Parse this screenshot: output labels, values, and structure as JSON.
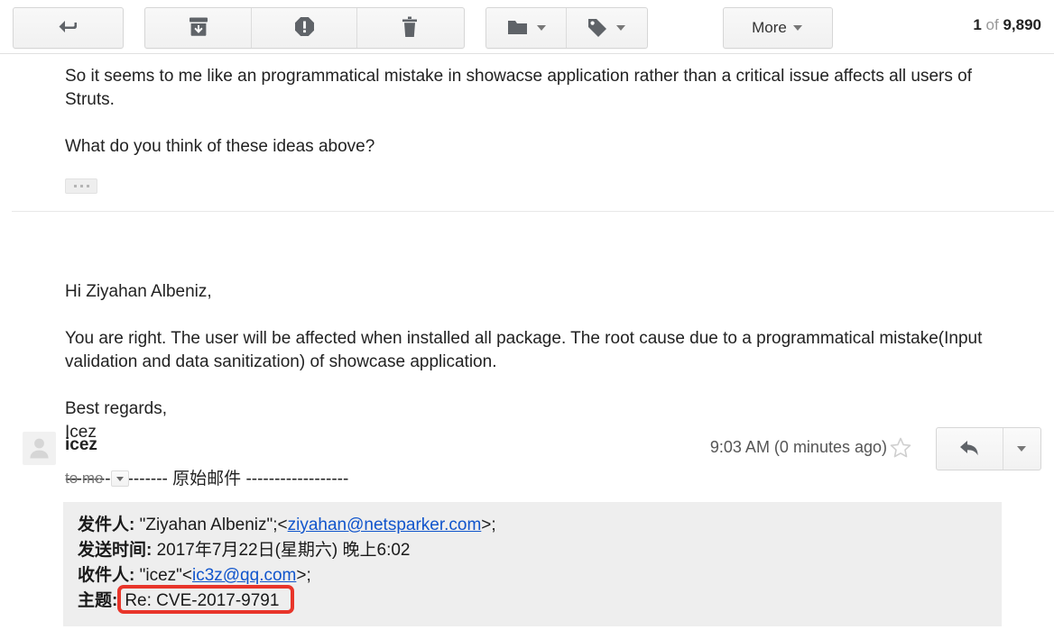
{
  "toolbar": {
    "buttons": [
      {
        "name": "back-to-inbox",
        "icon": "back-arrow-icon",
        "label": ""
      },
      {
        "name": "archive",
        "icon": "archive-icon",
        "label": ""
      },
      {
        "name": "report-spam",
        "icon": "report-spam-icon",
        "label": ""
      },
      {
        "name": "delete",
        "icon": "trash-icon",
        "label": ""
      },
      {
        "name": "move-to",
        "icon": "folder-icon",
        "label": ""
      },
      {
        "name": "labels",
        "icon": "tag-icon",
        "label": ""
      },
      {
        "name": "more",
        "icon": "chevron-down-icon",
        "label": "More"
      }
    ],
    "more_label": "More",
    "counter": {
      "current": "1",
      "separator": "of",
      "total": "9,890"
    }
  },
  "previous_message": {
    "paragraph_1": "So it seems to me like an programmatical mistake in showacse application rather than a critical issue affects all users of Struts.",
    "paragraph_2": "What do you think of these ideas above?",
    "trim_button_label": "•••"
  },
  "message": {
    "sender": "icez",
    "recipients": "to me",
    "timestamp": "9:03 AM (0 minutes ago)",
    "star_label": "Not starred",
    "reply_label": "Reply",
    "more_actions_label": "More options",
    "body": {
      "greeting": "Hi Ziyahan Albeniz,",
      "paragraph_1": "You are right. The user will be affected when installed all package. The root cause due to a programmatical mistake(Input validation and data sanitization) of showcase application.",
      "signoff": "Best regards,",
      "signature": "Icez"
    },
    "quote": {
      "separator": "------------------ 原始邮件 ------------------",
      "from_label": "发件人:",
      "from_value_prefix": " \"Ziyahan Albeniz\";<",
      "from_email": "ziyahan@netsparker.com",
      "from_value_suffix": ">;",
      "date_label": "发送时间:",
      "date_value": " 2017年7月22日(星期六) 晚上6:02",
      "to_label": "收件人:",
      "to_value_prefix": " \"icez\"<",
      "to_email": "ic3z@qq.com",
      "to_value_suffix": ">;",
      "subject_label": "主题:",
      "subject_value": "Re: CVE-2017-9791"
    }
  },
  "annotation": {
    "highlight_color": "#e8352a",
    "highlight_target": "Re: CVE-2017-9791"
  }
}
